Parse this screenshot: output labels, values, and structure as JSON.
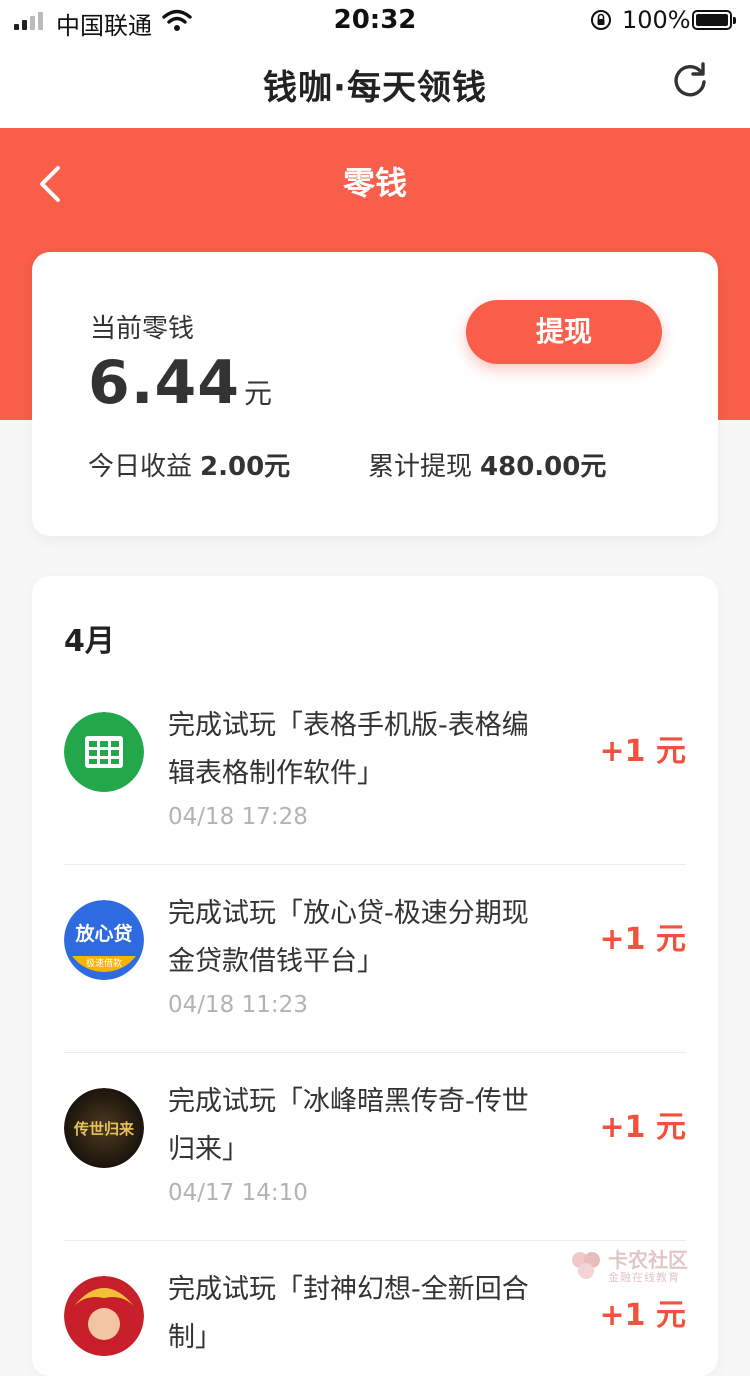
{
  "status_bar": {
    "carrier": "中国联通",
    "time": "20:32",
    "battery": "100%"
  },
  "nav": {
    "title": "钱咖·每天领钱",
    "refresh_icon": "refresh-icon"
  },
  "header": {
    "title": "零钱",
    "back_icon": "chevron-left-icon",
    "color": "#f85e4a"
  },
  "balance": {
    "label": "当前零钱",
    "amount": "6.44",
    "unit": "元",
    "withdraw_label": "提现",
    "today_label": "今日收益",
    "today_value": "2.00元",
    "total_label": "累计提现",
    "total_value": "480.00元"
  },
  "records": {
    "month": "4月",
    "items": [
      {
        "title": "完成试玩「表格手机版-表格编辑表格制作软件」",
        "time": "04/18 17:28",
        "amount": "+1 元",
        "icon": "spreadsheet-app-icon"
      },
      {
        "title": "完成试玩「放心贷-极速分期现金贷款借钱平台」",
        "time": "04/18 11:23",
        "amount": "+1 元",
        "icon": "loan-app-icon",
        "icon_text": "放心贷",
        "icon_sub": "极速借款"
      },
      {
        "title": "完成试玩「冰峰暗黑传奇-传世归来」",
        "time": "04/17 14:10",
        "amount": "+1 元",
        "icon": "game-app-icon",
        "icon_text": "传世归来"
      },
      {
        "title": "完成试玩「封神幻想-全新回合制」",
        "time": "",
        "amount": "+1 元",
        "icon": "fantasy-game-icon"
      }
    ]
  },
  "watermark": {
    "name": "卡农社区",
    "slogan": "金融在线教育"
  },
  "accent_color": "#f0523d"
}
